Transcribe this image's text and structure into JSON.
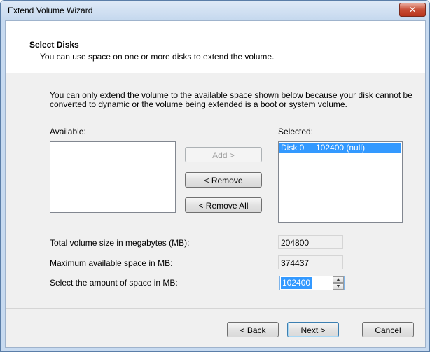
{
  "window": {
    "title": "Extend Volume Wizard",
    "close_glyph": "✕"
  },
  "header": {
    "title": "Select Disks",
    "subtitle": "You can use space on one or more disks to extend the volume."
  },
  "info": "You can only extend the volume to the available space shown below because your disk cannot be converted to dynamic or the volume being extended is a boot or system volume.",
  "available": {
    "label": "Available:",
    "items": []
  },
  "selected": {
    "label": "Selected:",
    "items": [
      {
        "text": "Disk 0     102400 (null)"
      }
    ]
  },
  "buttons": {
    "add": "Add >",
    "remove": "< Remove",
    "remove_all": "< Remove All",
    "back": "< Back",
    "next": "Next >",
    "cancel": "Cancel"
  },
  "fields": {
    "total_label": "Total volume size in megabytes (MB):",
    "total_value": "204800",
    "max_label": "Maximum available space in MB:",
    "max_value": "374437",
    "select_label": "Select the amount of space in MB:",
    "select_value": "102400"
  },
  "icons": {
    "spin_up": "▲",
    "spin_down": "▼"
  },
  "colors": {
    "selection": "#3399ff",
    "close_button": "#c74d35"
  }
}
